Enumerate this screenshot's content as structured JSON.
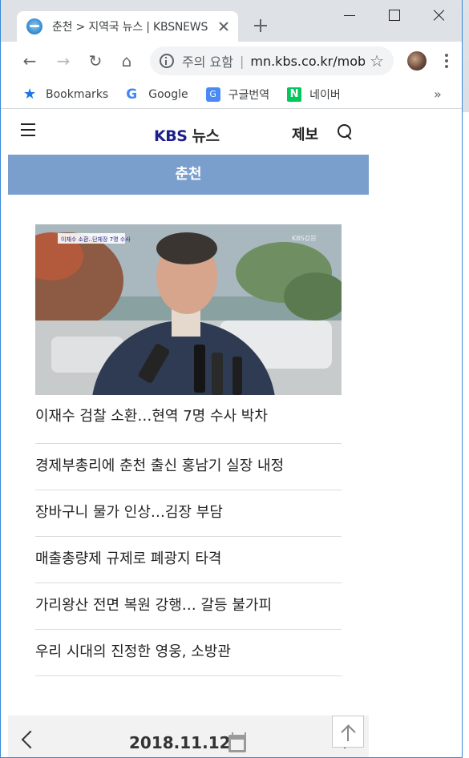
{
  "browser": {
    "tab_title": "춘천 > 지역국 뉴스 | KBSNEWS",
    "omnibox_warning": "주의 요함",
    "omnibox_separator": "|",
    "omnibox_url": "mn.kbs.co.kr/mobile/news/local/list.html",
    "bookmarks": [
      {
        "label": "Bookmarks",
        "icon": "star-icon"
      },
      {
        "label": "Google",
        "icon": "google-icon"
      },
      {
        "label": "구글번역",
        "icon": "translate-icon"
      },
      {
        "label": "네이버",
        "icon": "naver-icon"
      }
    ],
    "bookmarks_more": "»",
    "google_glyph": "G",
    "translate_glyph": "G",
    "naver_glyph": "N",
    "star_glyph": "★",
    "nav_glyphs": {
      "back": "←",
      "forward": "→",
      "reload": "↻",
      "home": "⌂",
      "bookmark_star": "☆"
    }
  },
  "site": {
    "logo_brand": "KBS",
    "logo_suffix": "뉴스",
    "report_label": "제보",
    "region_title": "춘천",
    "headline_image_caption": "이재수 소환‥단체장 7명 수사",
    "headline_image_watermark": "KBS강원",
    "news": [
      {
        "title": "이재수 검찰 소환…현역 7명 수사 박차"
      },
      {
        "title": "경제부총리에 춘천 출신 홍남기 실장 내정"
      },
      {
        "title": "장바구니 물가 인상…김장 부담"
      },
      {
        "title": "매출총량제 규제로 폐광지 타격"
      },
      {
        "title": "가리왕산 전면 복원 강행… 갈등 불가피"
      },
      {
        "title": "우리 시대의 진정한 영웅, 소방관"
      }
    ],
    "date": "2018.11.12"
  },
  "colors": {
    "region_bar": "#7b9fcc",
    "logo": "#1d2088",
    "tab_strip": "#dee1e6",
    "window_border": "#3a87d6"
  }
}
